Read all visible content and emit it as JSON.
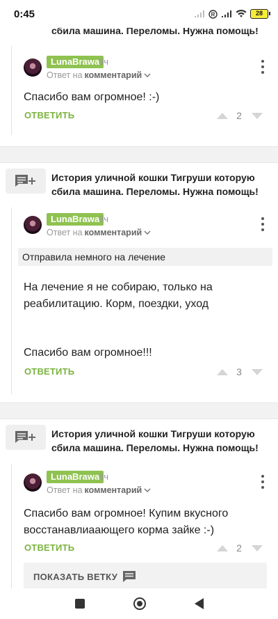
{
  "status_bar": {
    "time": "0:45",
    "battery": "28"
  },
  "post_title": "История уличной кошки Тигруши которую сбила машина. Переломы. Нужна помощь!",
  "post_title_partial": "сбила машина. Переломы. Нужна помощь!",
  "comments": [
    {
      "author": "LunaBrawa",
      "time": "9ч",
      "reply_prefix": "Ответ на",
      "reply_link": "комментарий",
      "text": "Спасибо вам огромное! :-)",
      "reply_label": "ОТВЕТИТЬ",
      "votes": "2"
    },
    {
      "author": "LunaBrawa",
      "time": "9ч",
      "reply_prefix": "Ответ на",
      "reply_link": "комментарий",
      "quote": "Отправила немного на лечение",
      "text_line1": "На лечение я не собираю, только на реабилитацию. Корм, поездки, уход",
      "text_line2": "Спасибо вам огромное!!!",
      "reply_label": "ОТВЕТИТЬ",
      "votes": "3"
    },
    {
      "author": "LunaBrawa",
      "time": "9ч",
      "reply_prefix": "Ответ на",
      "reply_link": "комментарий",
      "text": "Спасибо вам огромное! Купим вкусного восстанавлиаающего корма зайке :-)",
      "reply_label": "ОТВЕТИТЬ",
      "votes": "2",
      "show_thread": "ПОКАЗАТЬ ВЕТКУ"
    }
  ],
  "icons": {
    "post": "comment-add-icon",
    "more": "more-vertical-icon",
    "thread": "comment-icon"
  },
  "colors": {
    "accent": "#8fc250",
    "reply": "#7cb342"
  }
}
